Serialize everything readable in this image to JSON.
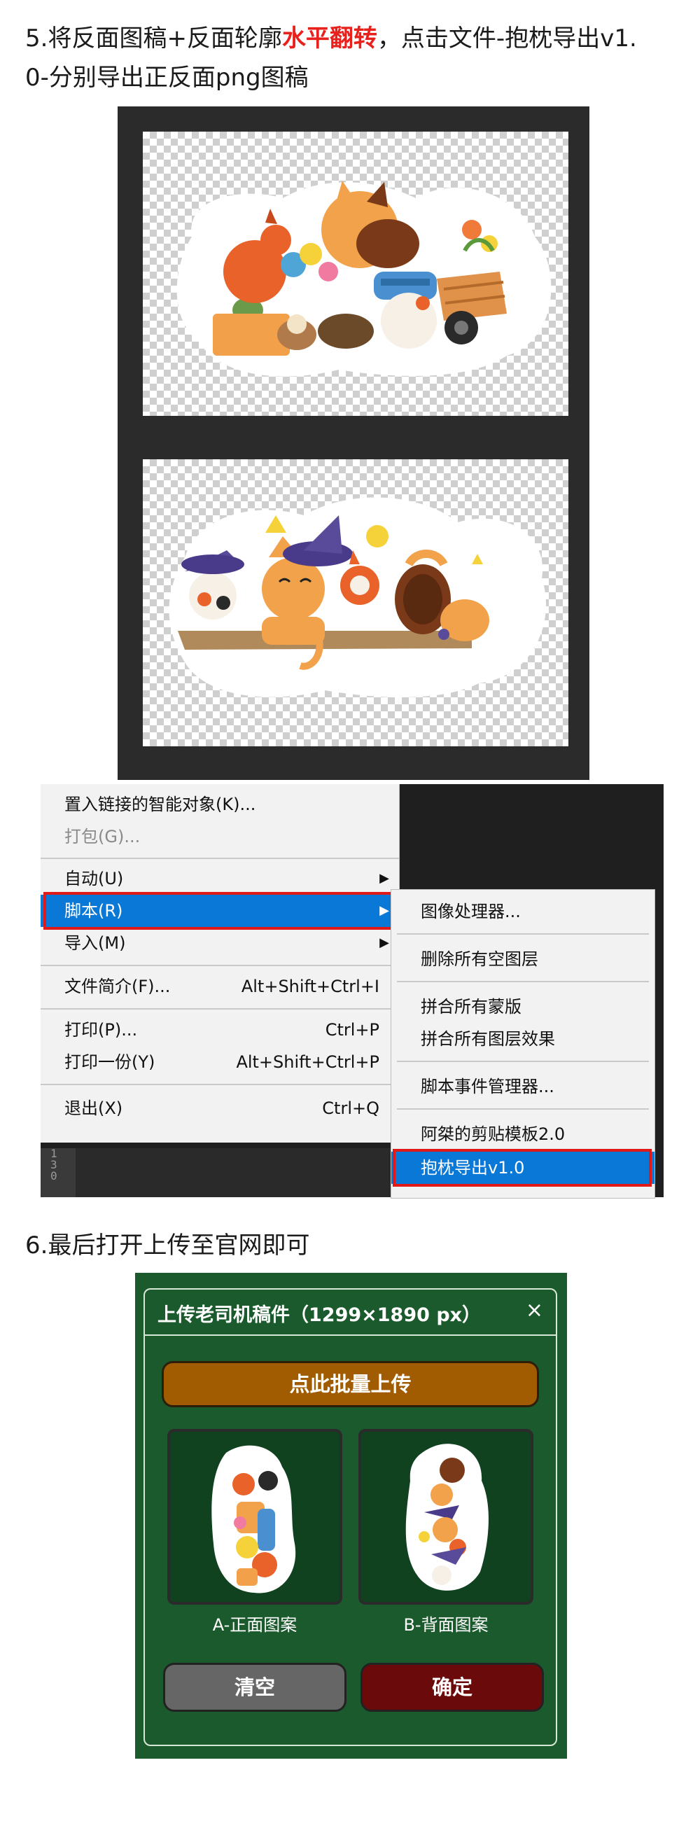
{
  "step5": {
    "line1_pre": "5.将反面图稿+反面轮廓",
    "line1_highlight": "水平翻转",
    "line1_post": "，点击文件-抱枕导出v1.",
    "line2": "0-分别导出正反面png图稿"
  },
  "file_menu": {
    "items": [
      {
        "label": "置入链接的智能对象(K)...",
        "shortcut": "",
        "disabled": false
      },
      {
        "label": "打包(G)...",
        "shortcut": "",
        "disabled": true
      },
      {
        "label": "自动(U)",
        "shortcut": "",
        "submenu": true
      },
      {
        "label": "脚本(R)",
        "shortcut": "",
        "submenu": true,
        "active": true
      },
      {
        "label": "导入(M)",
        "shortcut": "",
        "submenu": true
      },
      {
        "label": "文件简介(F)...",
        "shortcut": "Alt+Shift+Ctrl+I"
      },
      {
        "label": "打印(P)...",
        "shortcut": "Ctrl+P"
      },
      {
        "label": "打印一份(Y)",
        "shortcut": "Alt+Shift+Ctrl+P"
      },
      {
        "label": "退出(X)",
        "shortcut": "Ctrl+Q"
      }
    ],
    "submenu_arrow": "▶"
  },
  "script_submenu": {
    "items": [
      {
        "label": "图像处理器..."
      },
      {
        "label": "删除所有空图层"
      },
      {
        "label": "拼合所有蒙版"
      },
      {
        "label": "拼合所有图层效果"
      },
      {
        "label": "脚本事件管理器..."
      },
      {
        "label": "阿桀的剪贴模板2.0"
      },
      {
        "label": "抱枕导出v1.0",
        "active": true
      }
    ]
  },
  "ruler": {
    "digits": [
      "1",
      "3",
      "0"
    ]
  },
  "step6": {
    "text": "6.最后打开上传至官网即可"
  },
  "upload_dialog": {
    "title": "上传老司机稿件（1299×1890 px）",
    "close_icon": "×",
    "batch_upload_label": "点此批量上传",
    "slot_a_label": "A-正面图案",
    "slot_b_label": "B-背面图案",
    "clear_label": "清空",
    "confirm_label": "确定"
  },
  "colors": {
    "highlight": "#e8211c",
    "menu_active": "#0a78d7",
    "dialog_bg": "#1b5a2c",
    "batch_button": "#a15b00",
    "clear_button": "#666666",
    "confirm_button": "#6a0a0a"
  }
}
